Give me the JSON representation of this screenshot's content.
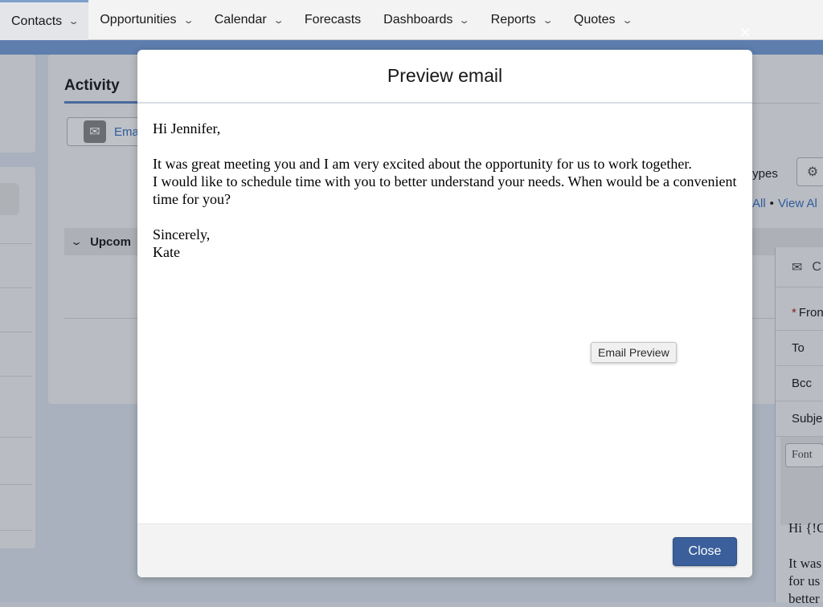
{
  "nav": {
    "tabs": [
      {
        "label": "Contacts",
        "dropdown": true
      },
      {
        "label": "Opportunities",
        "dropdown": true
      },
      {
        "label": "Calendar",
        "dropdown": true
      },
      {
        "label": "Forecasts",
        "dropdown": false
      },
      {
        "label": "Dashboards",
        "dropdown": true
      },
      {
        "label": "Reports",
        "dropdown": true
      },
      {
        "label": "Quotes",
        "dropdown": true
      }
    ],
    "active_tab": "Contacts"
  },
  "background": {
    "activity_tab": "Activity",
    "email_button": "Ema",
    "upcoming_section": "Upcom",
    "types_label": "types",
    "view_all_1": "All",
    "view_all_2": "View Al",
    "composer": {
      "header_letter": "C",
      "from_label": "Fron",
      "to_label": "To",
      "bcc_label": "Bcc",
      "subject_label": "Subje",
      "font_select": "Font",
      "body_line1": "Hi {!C",
      "body_line2": "It was",
      "body_line3": "for us",
      "body_line4": "better"
    }
  },
  "modal": {
    "title": "Preview email",
    "body": {
      "greeting": "Hi Jennifer,",
      "paragraph": "It was great meeting you and I am very excited about the opportunity for us to work together.\n I would like to schedule time with you to better understand your needs.  When would be a convenient time for you?",
      "closing": "Sincerely,\nKate"
    },
    "tooltip": "Email Preview",
    "close_label": "Close"
  },
  "colors": {
    "accent": "#3a5f9b",
    "overlay": "#b0b7c1",
    "link": "#2f5d9c"
  }
}
